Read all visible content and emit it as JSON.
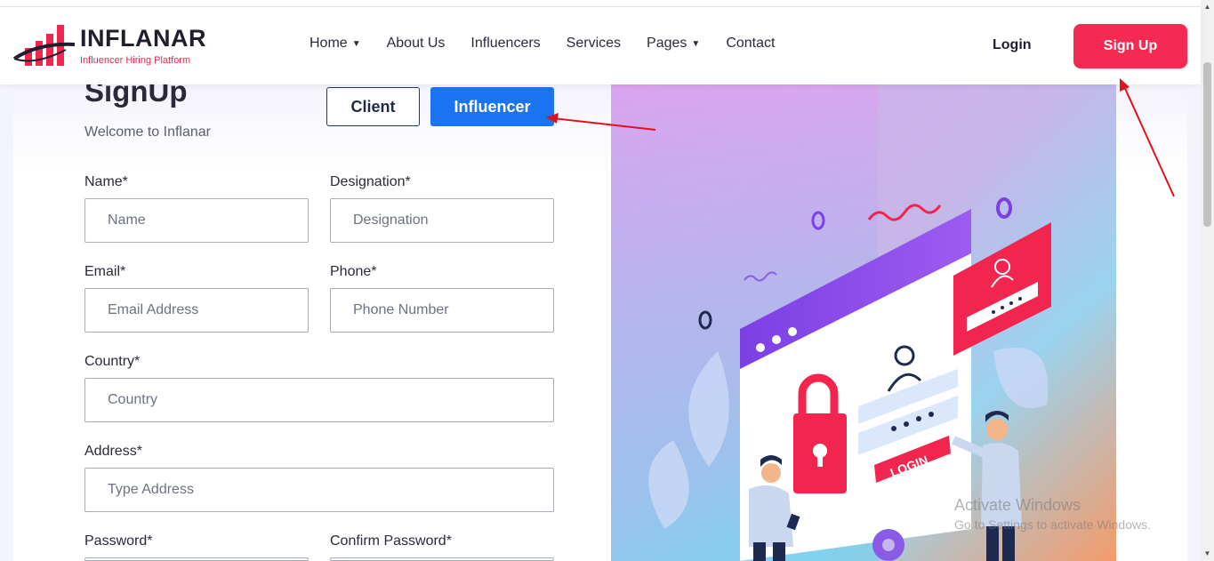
{
  "brand": {
    "name": "INFLANAR",
    "tagline": "Influencer Hiring Platform",
    "accent": "#f52a52"
  },
  "nav": {
    "items": [
      {
        "label": "Home",
        "has_dropdown": true
      },
      {
        "label": "About Us",
        "has_dropdown": false
      },
      {
        "label": "Influencers",
        "has_dropdown": false
      },
      {
        "label": "Services",
        "has_dropdown": false
      },
      {
        "label": "Pages",
        "has_dropdown": true
      },
      {
        "label": "Contact",
        "has_dropdown": false
      }
    ],
    "login_label": "Login",
    "signup_label": "Sign Up"
  },
  "form": {
    "title": "SignUp",
    "welcome": "Welcome to Inflanar",
    "role_client": "Client",
    "role_influencer": "Influencer",
    "fields": {
      "name": {
        "label": "Name*",
        "placeholder": "Name"
      },
      "designation": {
        "label": "Designation*",
        "placeholder": "Designation"
      },
      "email": {
        "label": "Email*",
        "placeholder": "Email Address"
      },
      "phone": {
        "label": "Phone*",
        "placeholder": "Phone Number"
      },
      "country": {
        "label": "Country*",
        "placeholder": "Country"
      },
      "address": {
        "label": "Address*",
        "placeholder": "Type Address"
      },
      "password": {
        "label": "Password*"
      },
      "confirm_password": {
        "label": "Confirm Password*"
      }
    }
  },
  "illustration": {
    "login_badge": "LOGIN"
  },
  "watermark": {
    "line1": "Activate Windows",
    "line2": "Go to Settings to activate Windows."
  }
}
